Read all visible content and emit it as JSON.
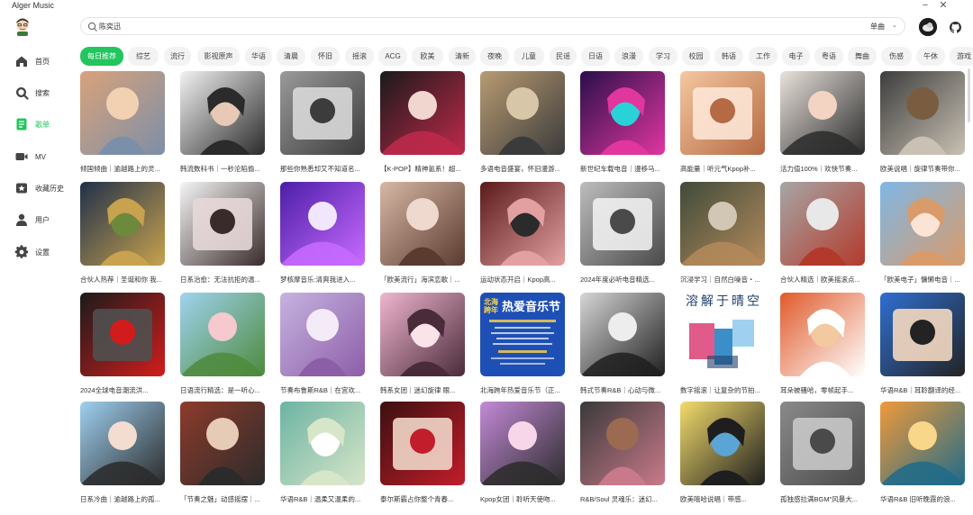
{
  "app": {
    "title": "Alger Music"
  },
  "nav": [
    {
      "label": "首页",
      "icon": "home-icon"
    },
    {
      "label": "搜索",
      "icon": "search-icon"
    },
    {
      "label": "歌单",
      "icon": "playlist-icon"
    },
    {
      "label": "MV",
      "icon": "video-icon"
    },
    {
      "label": "收藏历史",
      "icon": "history-icon"
    },
    {
      "label": "用户",
      "icon": "user-icon"
    },
    {
      "label": "设置",
      "icon": "gear-icon"
    }
  ],
  "active_nav": "歌单",
  "search": {
    "value": "陈奕迅",
    "type_label": "单曲"
  },
  "categories": [
    "每日推荐",
    "综艺",
    "流行",
    "影视原声",
    "华语",
    "清晨",
    "怀旧",
    "摇滚",
    "ACG",
    "欧美",
    "清新",
    "夜晚",
    "儿童",
    "民谣",
    "日语",
    "浪漫",
    "学习",
    "校园",
    "韩语",
    "工作",
    "电子",
    "粤语",
    "舞曲",
    "伤感",
    "午休",
    "游戏"
  ],
  "active_category": "每日推荐",
  "playlists": [
    {
      "title": "倾国倾曲｜逾越路上的灵..."
    },
    {
      "title": "韩流数科书｜一秒沦陷偷..."
    },
    {
      "title": "那些你熟悉却又不知道名..."
    },
    {
      "title": "【K-POP】精神氪系！超..."
    },
    {
      "title": "多语电音盛宴，怀旧漫游..."
    },
    {
      "title": "新世纪车载电音｜漫移马..."
    },
    {
      "title": "高能量｜听元气Kpop补..."
    },
    {
      "title": "活力值100%｜欢快节奏..."
    },
    {
      "title": "欧美说唱｜旋律节奏带你..."
    },
    {
      "title": "合伙人热荐｜圣诞和你 我..."
    },
    {
      "title": "日系治愈：无法抗拒的温..."
    },
    {
      "title": "梦核摩音乐:清爽我进入..."
    },
    {
      "title": "「欧美流行」海滨恋歌｜..."
    },
    {
      "title": "运动状态开启｜Kpop高..."
    },
    {
      "title": "2024年度必听电音精选..."
    },
    {
      "title": "沉浸学习｜自然白噪音・..."
    },
    {
      "title": "合伙人精选｜欧美摇滚点..."
    },
    {
      "title": "「欧美电子」慵懒电音｜..."
    },
    {
      "title": "2024全球电音潮流洪..."
    },
    {
      "title": "日语流行精选：是一听心..."
    },
    {
      "title": "节奏布鲁斯R&B｜在宫欢..."
    },
    {
      "title": "韩系女团｜迷幻旋律 眼..."
    },
    {
      "title": "北海跨年热爱音乐节（正..."
    },
    {
      "title": "韩式节奏R&B｜心动与微..."
    },
    {
      "title": "数字摇滚｜让复杂的节拍..."
    },
    {
      "title": "耳朵被骚哈，零帧起手..."
    },
    {
      "title": "华语R&B｜耳聆翻译的经..."
    },
    {
      "title": "日系冷曲｜逾越路上的孤..."
    },
    {
      "title": "「节奏之魅」动感摇摆｜..."
    },
    {
      "title": "华语R&B｜温柔又温柔的..."
    },
    {
      "title": "泰尔斯霸占你整个青春..."
    },
    {
      "title": "Kpop女团｜聆听天使吻..."
    },
    {
      "title": "R&B/Soul 灵魂乐：迷幻..."
    },
    {
      "title": "欧美嘻哈说唱｜带感..."
    },
    {
      "title": "孤独感拉满BGM\"风暴大..."
    },
    {
      "title": "华语R&B 旧听晚霞的浪..."
    }
  ],
  "festival_art": {
    "line1": "北海",
    "line2": "跨年",
    "headline": "热爱音乐节"
  },
  "melt_art": {
    "text": "溶解于晴空"
  },
  "colors": {
    "accent": "#22c55e"
  }
}
